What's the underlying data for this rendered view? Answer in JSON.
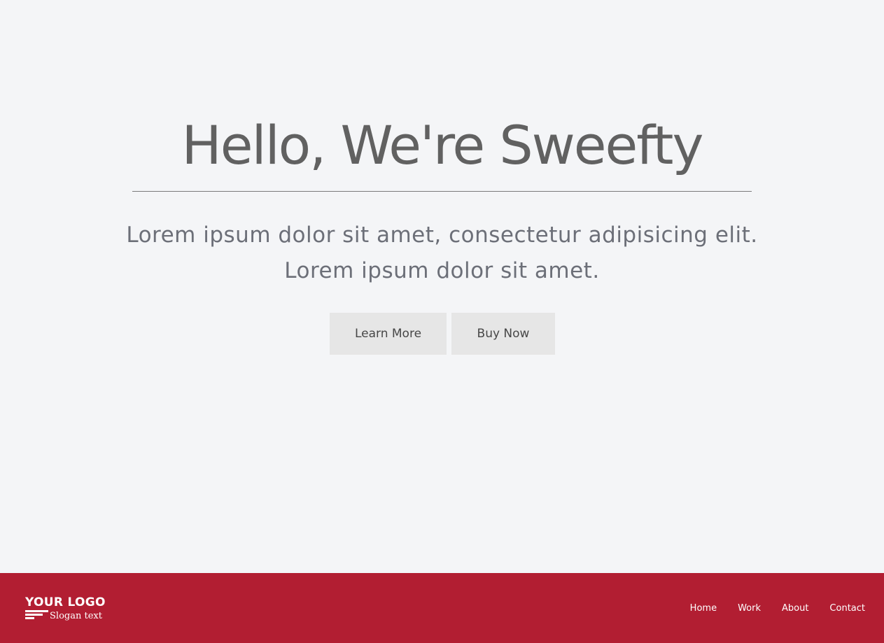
{
  "hero": {
    "title": "Hello, We're Sweefty",
    "subtitle_line1": "Lorem ipsum dolor sit amet, consectetur adipisicing elit.",
    "subtitle_line2": "Lorem ipsum dolor sit amet.",
    "learn_more_label": "Learn More",
    "buy_now_label": "Buy Now"
  },
  "footer": {
    "logo_text": "YOUR LOGO",
    "slogan": "Slogan text",
    "nav": [
      {
        "label": "Home"
      },
      {
        "label": "Work"
      },
      {
        "label": "About"
      },
      {
        "label": "Contact"
      }
    ]
  },
  "colors": {
    "background": "#f4f5f7",
    "footer": "#b21e32",
    "button": "#e6e6e6",
    "heading": "#616161"
  }
}
